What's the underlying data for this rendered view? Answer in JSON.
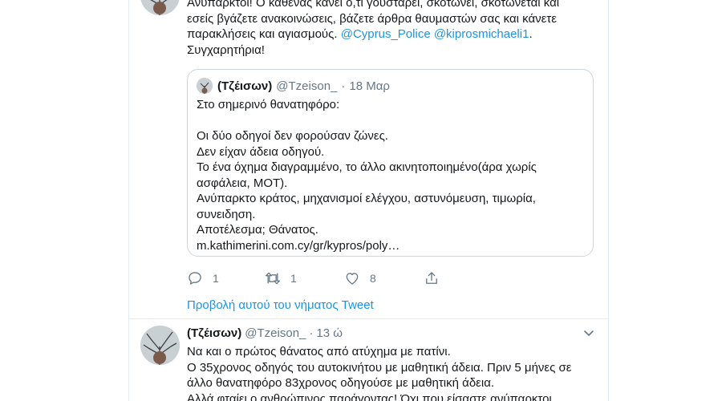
{
  "tweet1": {
    "text_lines": [
      "Ανύπαρκτοι! Ο καθένας κάνει ό,τι γουστάρει, σκοτώνει, σκοτώνεται και",
      "εσείς βγάζετε ανακοινώσεις, βάζετε άρθρα θαυμαστών σας και κάνετε",
      "παρακλήσεις και αγιασμούς."
    ],
    "mention_1": "@Cyprus_Police",
    "mention_2": "@kiprosmichaeli1",
    "after_mentions": ".",
    "closing_line": "Συγχαρητήρια!",
    "quote": {
      "name": "(Τζέισων)",
      "handle": "@Tzeison_",
      "separator": "·",
      "date": "18 Μαρ",
      "lines": [
        "Στο σημερινό θανατηφόρο:",
        "",
        "Οι δύο οδηγοί δεν φορούσαν ζώνες.",
        "Δεν είχαν άδεια οδηγού.",
        "Το ένα όχημα διαγραμμένο, το άλλο ακινητοποιημένο(άρα χωρίς",
        "ασφάλεια, ΜΟΤ).",
        "Ανύπαρκτο κράτος, μηχανισμοί ελέγχου, αστυνόμευση, τιμωρία,",
        "συνειδηση.",
        "Αποτέλεσμα; Θάνατος.",
        "m.kathimerini.com.cy/gr/kypros/poly…"
      ]
    },
    "actions": {
      "reply_icon": "reply-icon",
      "reply_count": "1",
      "retweet_icon": "retweet-icon",
      "retweet_count": "1",
      "like_icon": "heart-icon",
      "like_count": "8",
      "share_icon": "share-icon"
    },
    "thread_link": "Προβολή αυτού του νήματος Tweet"
  },
  "tweet2": {
    "name": "(Τζέισων)",
    "handle": "@Tzeison_",
    "separator": "·",
    "time": "13 ώ",
    "text_lines": [
      "Να και ο πρώτος θάνατος από ατύχημα με πατίνι.",
      "Ο 35χρονος οδηγός του αυτοκινήτου με μαθητική άδεια. Πριν 5 μήνες σε",
      "άλλο θανατηφόρο 83χρονος οδηγούσε με μαθητική άδεια.",
      "Αλλά φταίει ο ανθρώπινος παράγοντας! Όχι που είσαστε ανύπαρκτοι"
    ],
    "menu_icon": "chevron-down-icon"
  },
  "colors": {
    "link": "#1b95e0",
    "text": "#14171a",
    "muted": "#657786",
    "border": "#ccd6dd",
    "divider": "#e6ecf0"
  }
}
